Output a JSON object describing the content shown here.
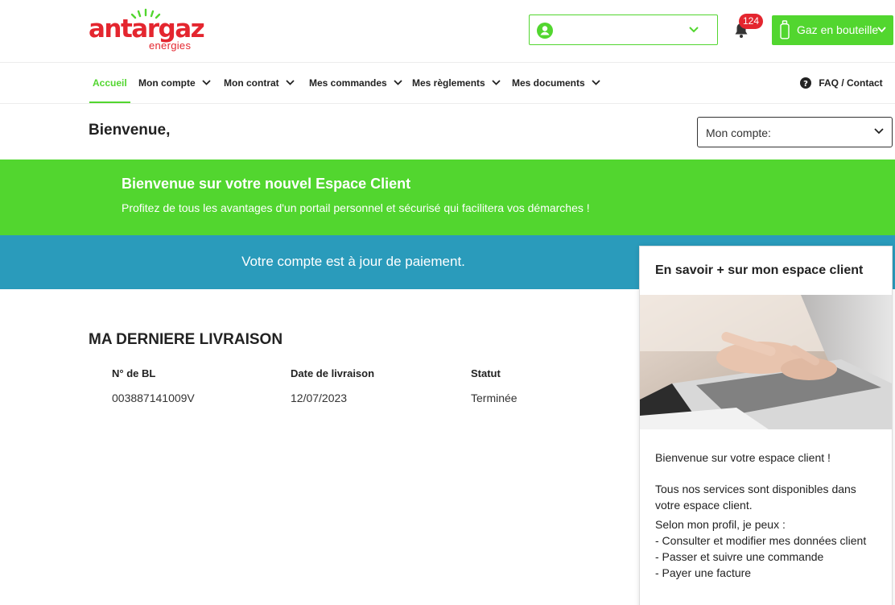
{
  "brand": {
    "name": "antargaz",
    "sub": "energies",
    "color": "#e4262f",
    "accent": "#52d62f"
  },
  "header": {
    "account_value": "",
    "notifications_count": "124",
    "gas_button_label": "Gaz en bouteille"
  },
  "nav": {
    "items": [
      {
        "label": "Accueil",
        "active": true
      },
      {
        "label": "Mon compte"
      },
      {
        "label": "Mon contrat"
      },
      {
        "label": "Mes commandes"
      },
      {
        "label": "Mes règlements"
      },
      {
        "label": "Mes documents"
      }
    ],
    "faq_label": "FAQ / Contact"
  },
  "welcome": {
    "title": "Bienvenue,",
    "account_dropdown": "Mon compte:"
  },
  "banner_green": {
    "title": "Bienvenue sur votre nouvel Espace Client",
    "subtitle": "Profitez de tous les avantages d'un portail personnel et sécurisé qui facilitera vos démarches !"
  },
  "banner_blue": {
    "text": "Votre compte est à jour de paiement."
  },
  "delivery": {
    "title": "MA DERNIERE LIVRAISON",
    "columns": [
      "N° de BL",
      "Date de livraison",
      "Statut"
    ],
    "row": [
      "003887141009V",
      "12/07/2023",
      "Terminée"
    ]
  },
  "side_card": {
    "title": "En savoir + sur mon espace client",
    "p1": "Bienvenue sur votre espace client !",
    "p2": "Tous nos services sont disponibles dans votre espace client.",
    "p3": "Selon mon profil, je peux :",
    "p4": "- Consulter et modifier mes données client",
    "p5": "- Passer et suivre une commande",
    "p6": "- Payer une facture"
  }
}
